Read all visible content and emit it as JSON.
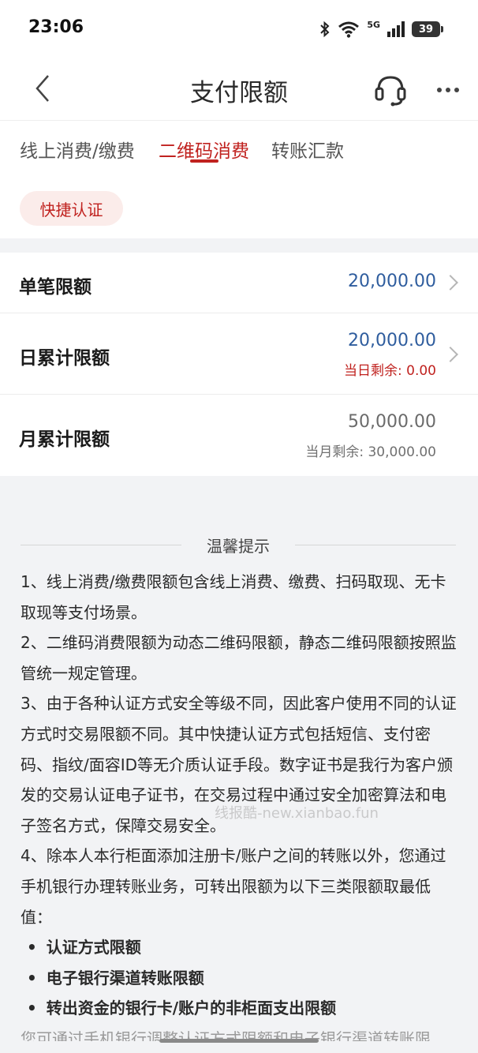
{
  "status_bar": {
    "time": "23:06",
    "network": "5G",
    "battery": "39",
    "icons": [
      "bluetooth-icon",
      "wifi-icon",
      "signal-icon",
      "battery-icon"
    ]
  },
  "nav": {
    "title": "支付限额",
    "back_icon": "chevron-left-icon",
    "service_icon": "headset-icon",
    "more_icon": "more-dots-icon"
  },
  "tabs": [
    {
      "label": "线上消费/缴费",
      "active": false
    },
    {
      "label": "二维码消费",
      "active": true
    },
    {
      "label": "转账汇款",
      "active": false
    }
  ],
  "auth_pill": "快捷认证",
  "limits": [
    {
      "label": "单笔限额",
      "value": "20,000.00",
      "sub": ""
    },
    {
      "label": "日累计限额",
      "value": "20,000.00",
      "sub": "当日剩余: 0.00"
    },
    {
      "label": "月累计限额",
      "value": "50,000.00",
      "sub": "当月剩余: 30,000.00"
    }
  ],
  "tips": {
    "title": "温馨提示",
    "p1": "1、线上消费/缴费限额包含线上消费、缴费、扫码取现、无卡取现等支付场景。",
    "p2": "2、二维码消费限额为动态二维码限额，静态二维码限额按照监管统一规定管理。",
    "p3": "3、由于各种认证方式安全等级不同，因此客户使用不同的认证方式时交易限额不同。其中快捷认证方式包括短信、支付密码、指纹/面容ID等无介质认证手段。数字证书是我行为客户颁发的交易认证电子证书，在交易过程中通过安全加密算法和电子签名方式，保障交易安全。",
    "p4": "4、除本人本行柜面添加注册卡/账户之间的转账以外，您通过手机银行办理转账业务，可转出限额为以下三类限额取最低值：",
    "bullets": [
      "认证方式限额",
      "电子银行渠道转账限额",
      "转出资金的银行卡/账户的非柜面支出限额"
    ],
    "cut": "您可通过手机银行调整认证方式限额和电子银行渠道转账限额，提升"
  },
  "watermark": "线报酷-new.xianbao.fun"
}
